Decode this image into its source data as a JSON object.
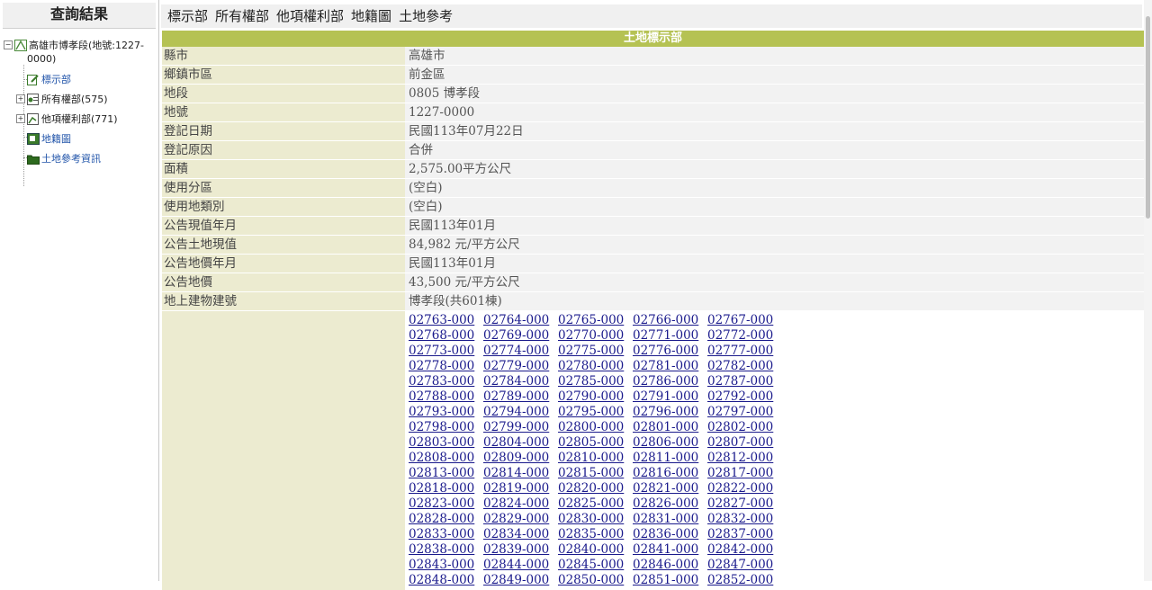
{
  "left_panel": {
    "title": "查詢結果",
    "root": "高雄市博孝段(地號:1227-",
    "root_cont": "0000)",
    "items": [
      {
        "label": "標示部"
      },
      {
        "label": "所有權部(575)"
      },
      {
        "label": "他項權利部(771)"
      },
      {
        "label": "地籍圖"
      },
      {
        "label": "土地參考資訊"
      }
    ]
  },
  "tabs": [
    "標示部",
    "所有權部",
    "他項權利部",
    "地籍圖",
    "土地參考"
  ],
  "table": {
    "title": "土地標示部",
    "rows": [
      {
        "key": "縣市",
        "value": "高雄市"
      },
      {
        "key": "鄉鎮市區",
        "value": "前金區"
      },
      {
        "key": "地段",
        "value": "0805 博孝段"
      },
      {
        "key": "地號",
        "value": "1227-0000"
      },
      {
        "key": "登記日期",
        "value": "民國113年07月22日"
      },
      {
        "key": "登記原因",
        "value": "合併"
      },
      {
        "key": "面積",
        "value": "2,575.00平方公尺"
      },
      {
        "key": "使用分區",
        "value": "(空白)"
      },
      {
        "key": "使用地類別",
        "value": "(空白)"
      },
      {
        "key": "公告現值年月",
        "value": "民國113年01月"
      },
      {
        "key": "公告土地現值",
        "value": "84,982 元/平方公尺"
      },
      {
        "key": "公告地價年月",
        "value": "民國113年01月"
      },
      {
        "key": "公告地價",
        "value": "43,500 元/平方公尺"
      },
      {
        "key": "地上建物建號",
        "value": "博孝段(共601棟)"
      }
    ],
    "building_numbers": [
      "02763-000",
      "02764-000",
      "02765-000",
      "02766-000",
      "02767-000",
      "02768-000",
      "02769-000",
      "02770-000",
      "02771-000",
      "02772-000",
      "02773-000",
      "02774-000",
      "02775-000",
      "02776-000",
      "02777-000",
      "02778-000",
      "02779-000",
      "02780-000",
      "02781-000",
      "02782-000",
      "02783-000",
      "02784-000",
      "02785-000",
      "02786-000",
      "02787-000",
      "02788-000",
      "02789-000",
      "02790-000",
      "02791-000",
      "02792-000",
      "02793-000",
      "02794-000",
      "02795-000",
      "02796-000",
      "02797-000",
      "02798-000",
      "02799-000",
      "02800-000",
      "02801-000",
      "02802-000",
      "02803-000",
      "02804-000",
      "02805-000",
      "02806-000",
      "02807-000",
      "02808-000",
      "02809-000",
      "02810-000",
      "02811-000",
      "02812-000",
      "02813-000",
      "02814-000",
      "02815-000",
      "02816-000",
      "02817-000",
      "02818-000",
      "02819-000",
      "02820-000",
      "02821-000",
      "02822-000",
      "02823-000",
      "02824-000",
      "02825-000",
      "02826-000",
      "02827-000",
      "02828-000",
      "02829-000",
      "02830-000",
      "02831-000",
      "02832-000",
      "02833-000",
      "02834-000",
      "02835-000",
      "02836-000",
      "02837-000",
      "02838-000",
      "02839-000",
      "02840-000",
      "02841-000",
      "02842-000",
      "02843-000",
      "02844-000",
      "02845-000",
      "02846-000",
      "02847-000",
      "02848-000",
      "02849-000",
      "02850-000",
      "02851-000",
      "02852-000"
    ]
  },
  "colors": {
    "title_bar": "#b5c253",
    "key_bg": "#ecebd0",
    "link": "#1a1a8c"
  }
}
